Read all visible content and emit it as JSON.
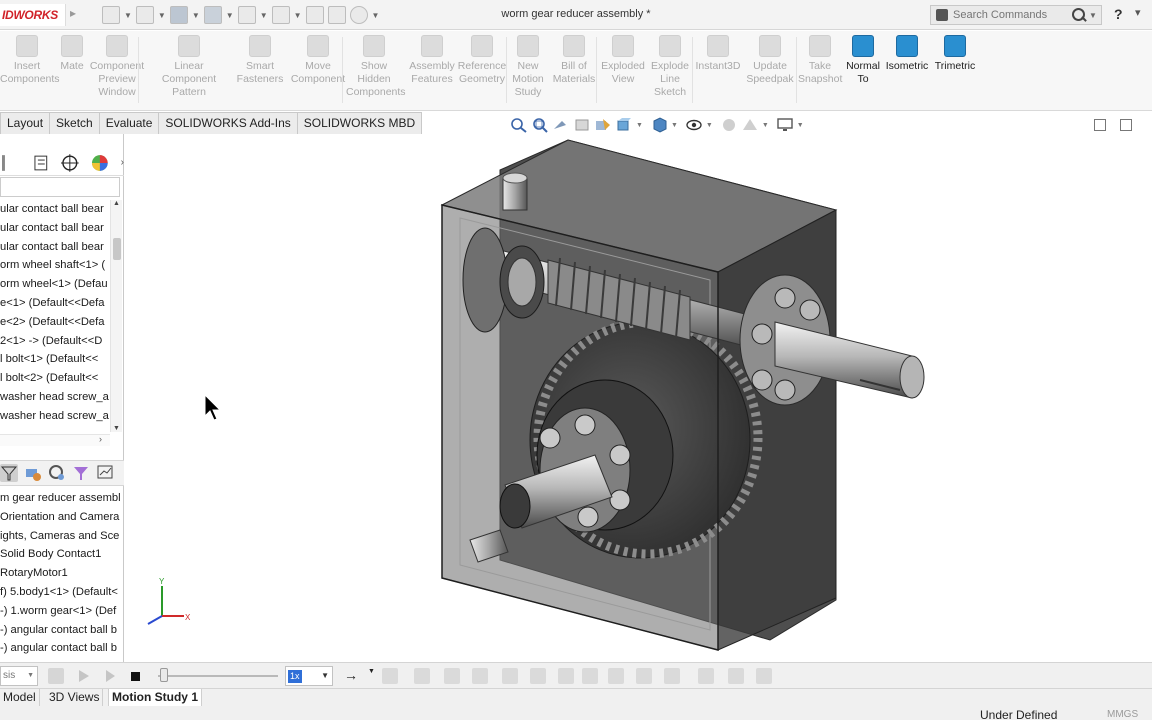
{
  "app": {
    "logo_text": "IDWORKS",
    "document_title": "worm gear reducer assembly *",
    "search_placeholder": "Search Commands",
    "help_label": "?",
    "units": "MMGS",
    "status": "Under Defined"
  },
  "ribbon": {
    "buttons": [
      {
        "label": "Insert\nComponents",
        "enabled": false
      },
      {
        "label": "Mate",
        "enabled": false
      },
      {
        "label": "Component\nPreview\nWindow",
        "enabled": false
      },
      {
        "label": "Linear Component\nPattern",
        "enabled": false
      },
      {
        "label": "Smart\nFasteners",
        "enabled": false
      },
      {
        "label": "Move\nComponent",
        "enabled": false
      },
      {
        "label": "Show\nHidden\nComponents",
        "enabled": false
      },
      {
        "label": "Assembly\nFeatures",
        "enabled": false
      },
      {
        "label": "Reference\nGeometry",
        "enabled": false
      },
      {
        "label": "New\nMotion\nStudy",
        "enabled": false
      },
      {
        "label": "Bill of\nMaterials",
        "enabled": false
      },
      {
        "label": "Exploded\nView",
        "enabled": false
      },
      {
        "label": "Explode\nLine\nSketch",
        "enabled": false
      },
      {
        "label": "Instant3D",
        "enabled": false
      },
      {
        "label": "Update\nSpeedpak",
        "enabled": false
      },
      {
        "label": "Take\nSnapshot",
        "enabled": false
      },
      {
        "label": "Normal\nTo",
        "enabled": true
      },
      {
        "label": "Isometric",
        "enabled": true
      },
      {
        "label": "Trimetric",
        "enabled": true
      }
    ]
  },
  "command_tabs": [
    "Layout",
    "Sketch",
    "Evaluate",
    "SOLIDWORKS Add-Ins",
    "SOLIDWORKS MBD"
  ],
  "feature_tree": {
    "items": [
      "ular contact ball bear",
      "ular contact ball bear",
      "ular contact ball bear",
      "orm wheel shaft<1> (",
      "orm wheel<1> (Defau",
      "e<1> (Default<<Defa",
      "e<2> (Default<<Defa",
      "2<1> -> (Default<<D",
      "l bolt<1> (Default<<",
      "l bolt<2> (Default<<",
      " washer head screw_a",
      " washer head screw_a"
    ]
  },
  "motion_tree": {
    "items": [
      "m gear reducer assembl",
      "Orientation and Camera",
      "ights, Cameras and Sce",
      "Solid Body Contact1",
      "RotaryMotor1",
      "f) 5.body1<1> (Default<",
      "-) 1.worm gear<1> (Def",
      "-) angular contact ball b",
      "-) angular contact ball b"
    ]
  },
  "motion_toolbar": {
    "study_type": "sis",
    "playback_speed": "1x"
  },
  "bottom_tabs": [
    "Model",
    "3D Views",
    "Motion Study 1"
  ],
  "active_bottom_tab": "Motion Study 1",
  "triad": {
    "x_label": "X",
    "y_label": "Y"
  },
  "colors": {
    "brand_red": "#d1232a",
    "cube_blue": "#2a8fd0",
    "housing": "#5b5b5b",
    "accent_blue": "#2f6fd8"
  }
}
